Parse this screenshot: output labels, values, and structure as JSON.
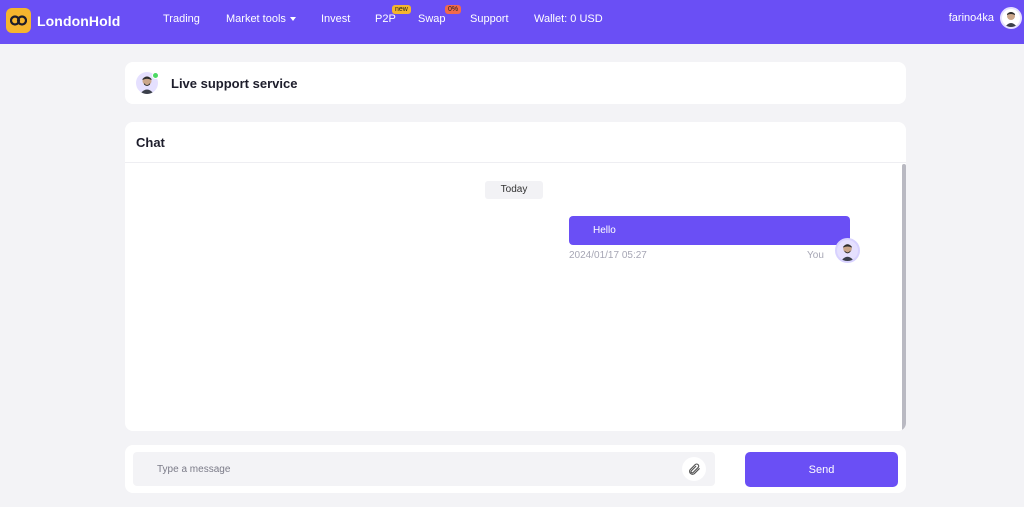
{
  "brand": {
    "name": "LondonHold",
    "logo_icon": "link-icon",
    "logo_color": "#f5b52e"
  },
  "theme": {
    "accent": "#6a4ff5",
    "online": "#4cd964"
  },
  "nav": {
    "items": [
      {
        "label": "Trading"
      },
      {
        "label": "Market tools",
        "has_dropdown": true
      },
      {
        "label": "Invest"
      },
      {
        "label": "P2P",
        "badge": "new"
      },
      {
        "label": "Swap",
        "badge": "0%"
      },
      {
        "label": "Support"
      }
    ],
    "wallet": "Wallet: 0 USD",
    "username": "farino4ka"
  },
  "support": {
    "title": "Live support service"
  },
  "chat": {
    "title": "Chat",
    "date_divider": "Today",
    "messages": [
      {
        "text": "Hello",
        "time": "2024/01/17 05:27",
        "sender": "You"
      }
    ]
  },
  "composer": {
    "placeholder": "Type a message",
    "attach_icon": "paperclip-icon",
    "send_label": "Send"
  }
}
